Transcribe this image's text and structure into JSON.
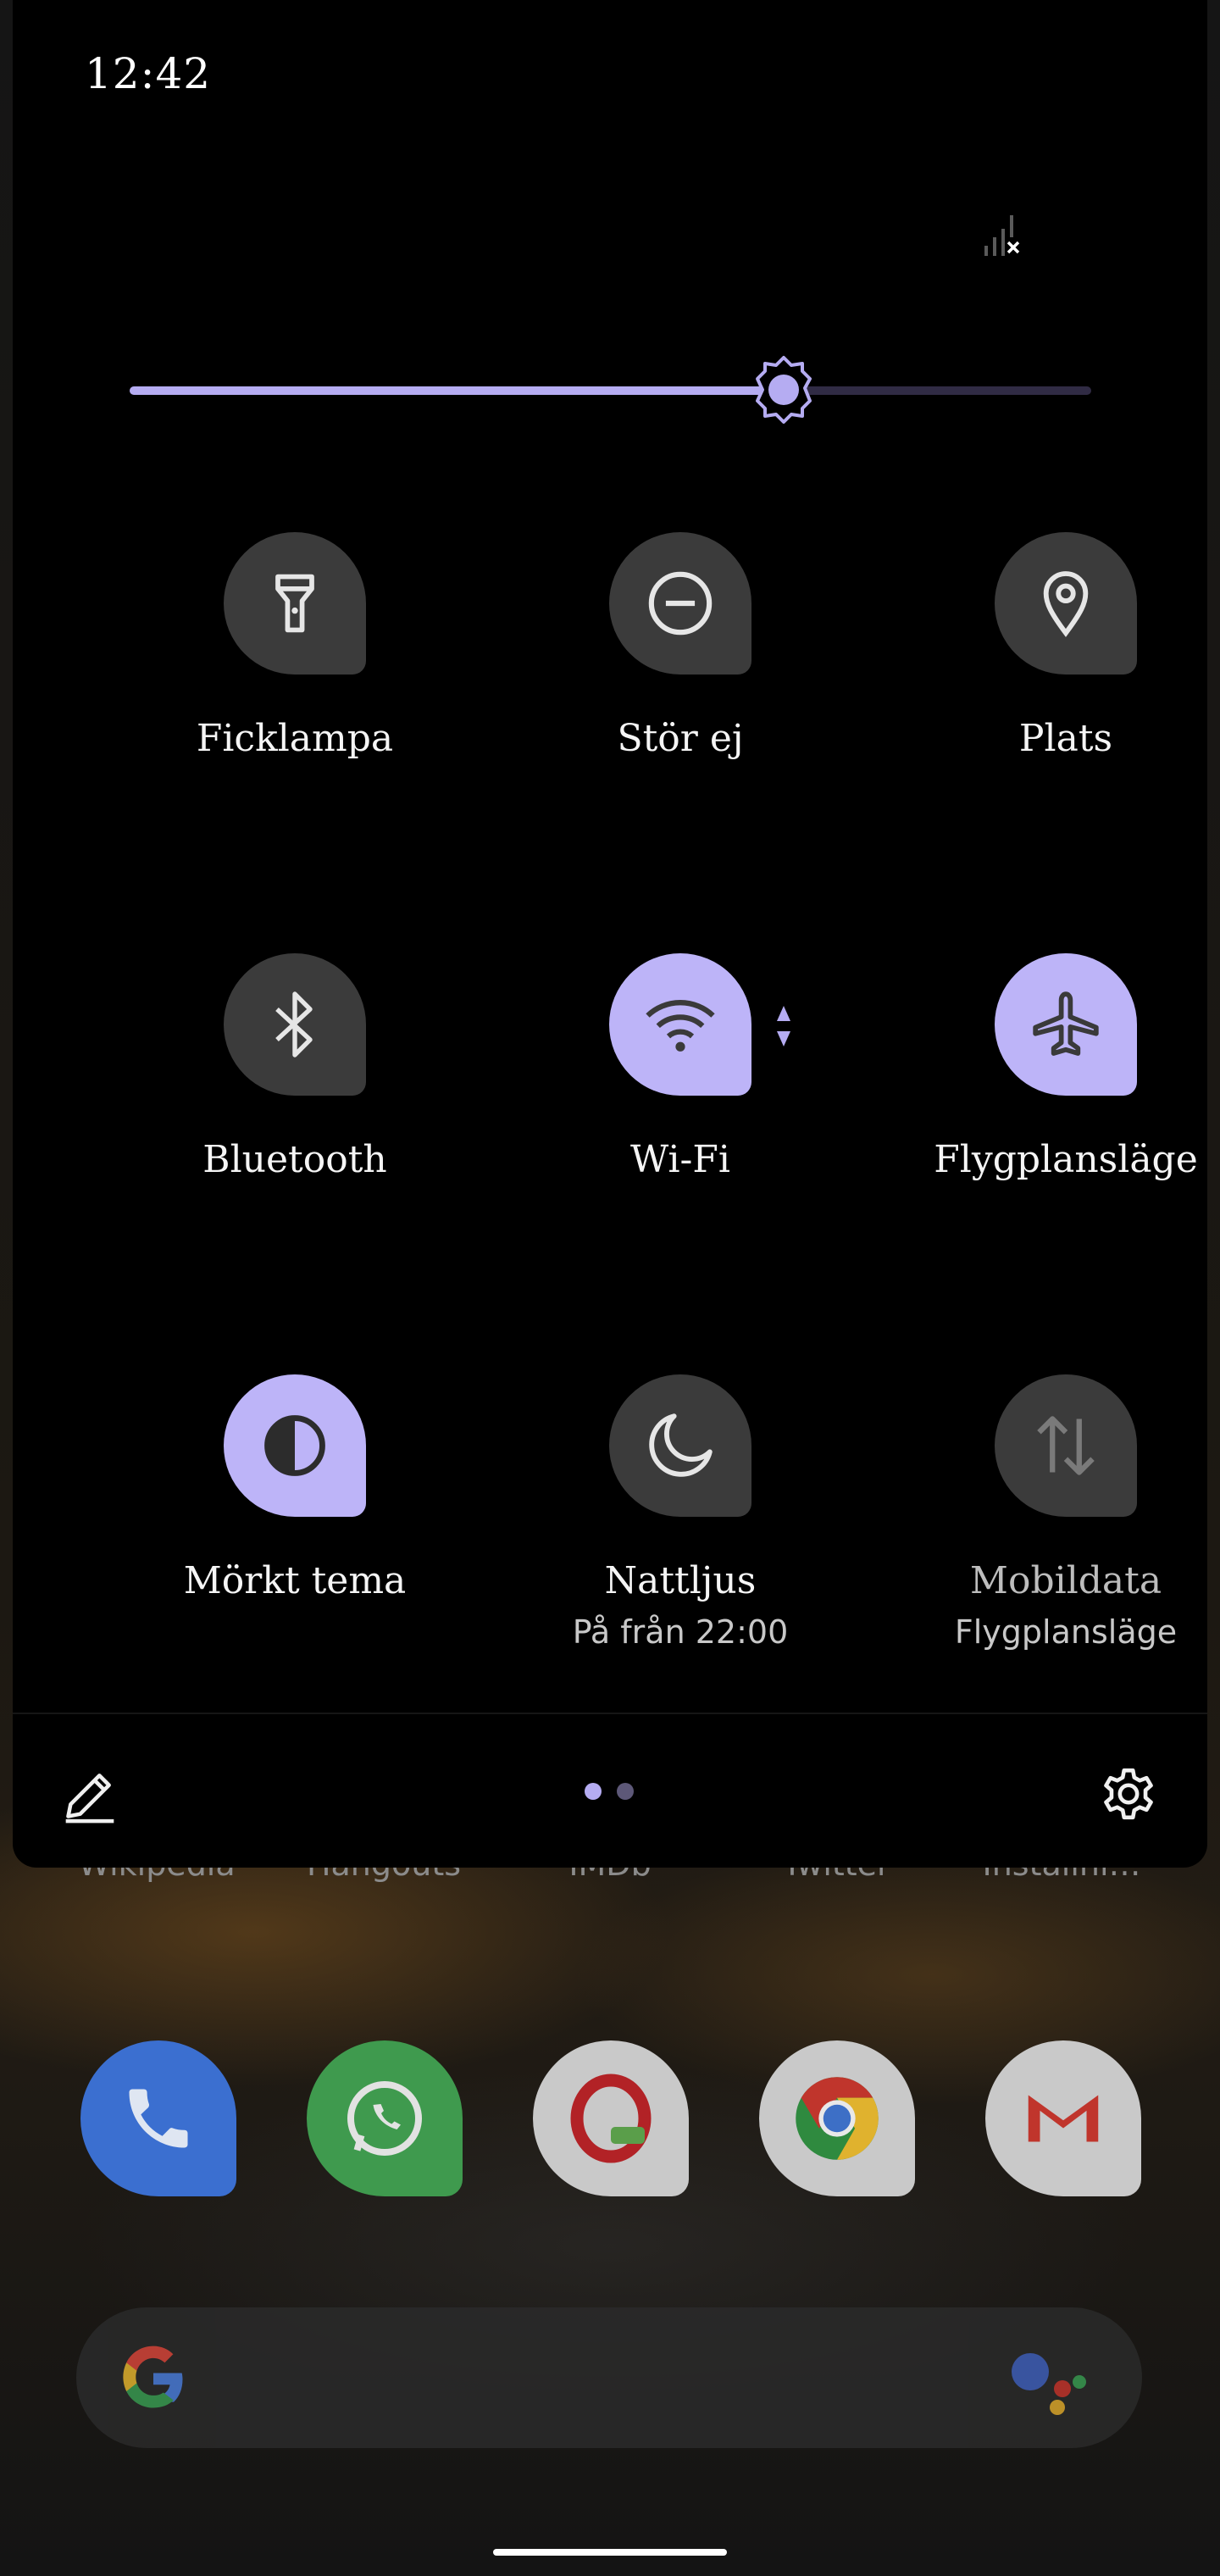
{
  "status_bar": {
    "time": "12:42"
  },
  "colors": {
    "accent": "#b5acf2",
    "tile_active": "#bdb4f8",
    "tile_inactive": "#3b3b3b",
    "shade_bg": "#000000"
  },
  "brightness": {
    "level": 0.68
  },
  "tiles": [
    {
      "label": "Ficklampa",
      "icon": "flashlight-icon",
      "active": false
    },
    {
      "label": "Stör ej",
      "icon": "do-not-disturb-icon",
      "active": false
    },
    {
      "label": "Plats",
      "icon": "location-pin-icon",
      "active": false
    },
    {
      "label": "Bluetooth",
      "icon": "bluetooth-icon",
      "active": false
    },
    {
      "label": "Wi-Fi",
      "icon": "wifi-icon",
      "active": true
    },
    {
      "label": "Flygplansläge",
      "icon": "airplane-icon",
      "active": true
    },
    {
      "label": "Mörkt tema",
      "icon": "dark-theme-icon",
      "active": true
    },
    {
      "label": "Nattljus",
      "sublabel": "På från 22:00",
      "icon": "moon-icon",
      "active": false
    },
    {
      "label": "Mobildata",
      "sublabel": "Flygplansläge",
      "icon": "mobile-data-icon",
      "active": false,
      "disabled": true
    }
  ],
  "footer": {
    "page_count": 2,
    "current_page": 1
  },
  "home": {
    "app_labels": [
      "Wikipedia",
      "Hangouts",
      "IMDb",
      "Twitter",
      "Installni…"
    ],
    "dock_apps": [
      "phone-app-icon",
      "whatsapp-app-icon",
      "opera-mini-app-icon",
      "chrome-app-icon",
      "gmail-app-icon"
    ]
  }
}
